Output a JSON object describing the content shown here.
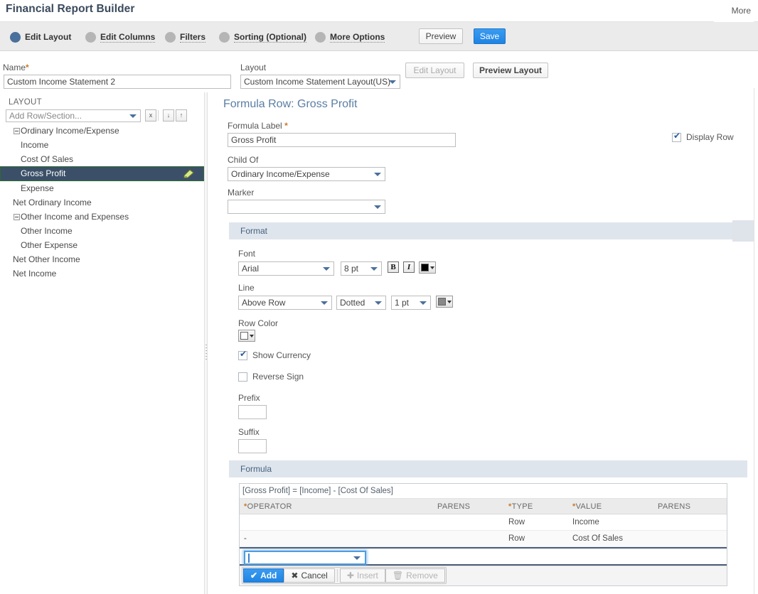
{
  "header": {
    "title": "Financial Report Builder",
    "more_label": "More"
  },
  "stepper": {
    "steps": [
      {
        "label": "Edit Layout",
        "active": true
      },
      {
        "label": "Edit Columns",
        "active": false
      },
      {
        "label": "Filters",
        "active": false
      },
      {
        "label": "Sorting (Optional)",
        "active": false
      },
      {
        "label": "More Options",
        "active": false
      }
    ],
    "preview_label": "Preview",
    "save_label": "Save",
    "active_dot_color": "#4a709c",
    "inactive_dot_color": "#b5b5b5"
  },
  "toprow": {
    "name_label": "Name",
    "name_required": "*",
    "name_value": "Custom Income Statement 2",
    "layout_label": "Layout",
    "layout_value": "Custom Income Statement Layout(US)",
    "edit_layout_label": "Edit Layout",
    "preview_layout_label": "Preview Layout"
  },
  "left_panel": {
    "caption": "LAYOUT",
    "add_row_value": "Add Row/Section...",
    "btn_delete": "x",
    "btn_move_down": "↓",
    "btn_move_up": "↑",
    "tree": [
      {
        "label": "Ordinary Income/Expense",
        "indent": 0,
        "toggle": true,
        "selected": false
      },
      {
        "label": "Income",
        "indent": 2,
        "toggle": false,
        "selected": false
      },
      {
        "label": "Cost Of Sales",
        "indent": 2,
        "toggle": false,
        "selected": false
      },
      {
        "label": "Gross Profit",
        "indent": 2,
        "toggle": false,
        "selected": true
      },
      {
        "label": "Expense",
        "indent": 2,
        "toggle": false,
        "selected": false
      },
      {
        "label": "Net Ordinary Income",
        "indent": 1,
        "toggle": false,
        "selected": false
      },
      {
        "label": "Other Income and Expenses",
        "indent": 0,
        "toggle": true,
        "selected": false
      },
      {
        "label": "Other Income",
        "indent": 2,
        "toggle": false,
        "selected": false
      },
      {
        "label": "Other Expense",
        "indent": 2,
        "toggle": false,
        "selected": false
      },
      {
        "label": "Net Other Income",
        "indent": 1,
        "toggle": false,
        "selected": false
      },
      {
        "label": "Net Income",
        "indent": 1,
        "toggle": false,
        "selected": false
      }
    ],
    "selected_row_bg": "#3b5068",
    "selected_row_border": "#2d6b2d"
  },
  "detail": {
    "title": "Formula Row: Gross Profit",
    "formula_label_label": "Formula Label",
    "formula_label_required": "*",
    "formula_label_value": "Gross Profit",
    "display_row_label": "Display Row",
    "display_row_checked": true,
    "child_of_label": "Child Of",
    "child_of_value": "Ordinary Income/Expense",
    "marker_label": "Marker",
    "marker_value": ""
  },
  "format": {
    "section_title": "Format",
    "font_label": "Font",
    "font_value": "Arial",
    "font_size_value": "8 pt",
    "bold_label": "B",
    "italic_label": "I",
    "font_color": "#000000",
    "line_label": "Line",
    "line_position_value": "Above Row",
    "line_style_value": "Dotted",
    "line_width_value": "1 pt",
    "line_color": "#888888",
    "row_color_label": "Row Color",
    "row_color": "#ffffff",
    "show_currency_label": "Show Currency",
    "show_currency_checked": true,
    "reverse_sign_label": "Reverse Sign",
    "reverse_sign_checked": false,
    "prefix_label": "Prefix",
    "prefix_value": "",
    "suffix_label": "Suffix",
    "suffix_value": ""
  },
  "formula": {
    "section_title": "Formula",
    "expression": "[Gross Profit] = [Income] - [Cost Of Sales]",
    "columns": [
      {
        "label": "OPERATOR",
        "required": true
      },
      {
        "label": "PARENS",
        "required": false
      },
      {
        "label": "TYPE",
        "required": true
      },
      {
        "label": "VALUE",
        "required": true
      },
      {
        "label": "PARENS",
        "required": false
      }
    ],
    "rows": [
      {
        "operator": "",
        "parens1": "",
        "type": "Row",
        "value": "Income",
        "parens2": ""
      },
      {
        "operator": "-",
        "parens1": "",
        "type": "Row",
        "value": "Cost Of Sales",
        "parens2": ""
      }
    ],
    "edit_row_value": "",
    "actions": [
      {
        "label": "Add",
        "icon": "✔",
        "style": "primary",
        "disabled": false
      },
      {
        "label": "Cancel",
        "icon": "✖",
        "style": "plain",
        "disabled": false
      },
      {
        "label": "Insert",
        "icon": "✚",
        "style": "disabled",
        "disabled": true
      },
      {
        "label": "Remove",
        "icon": "Ὕ1",
        "style": "disabled",
        "disabled": true
      }
    ]
  }
}
